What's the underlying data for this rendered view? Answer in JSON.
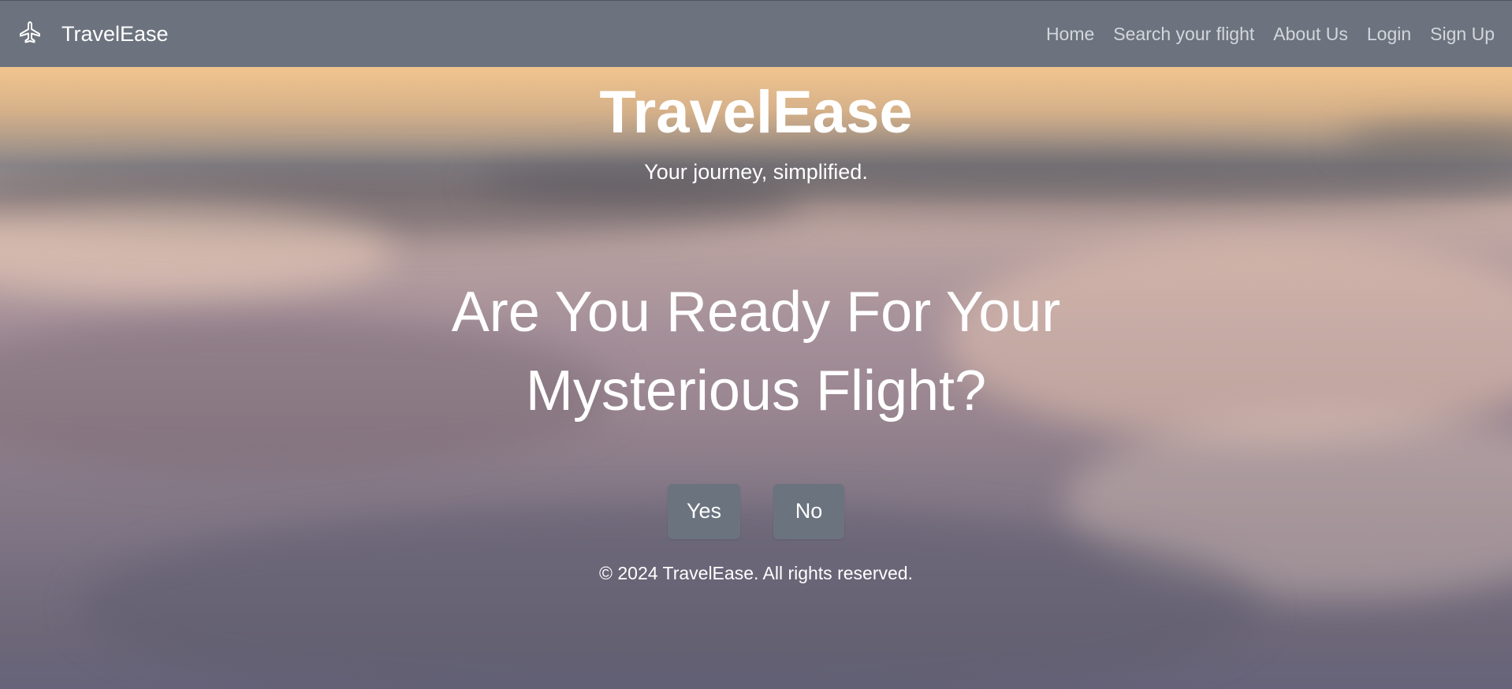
{
  "navbar": {
    "brand_icon": "airplane-icon",
    "brand": "TravelEase",
    "links": [
      "Home",
      "Search your flight",
      "About Us",
      "Login",
      "Sign Up"
    ]
  },
  "hero": {
    "title": "TravelEase",
    "tagline": "Your journey, simplified.",
    "question_line1": "Are You Ready For Your",
    "question_line2": "Mysterious Flight?",
    "yes_label": "Yes",
    "no_label": "No"
  },
  "footer": {
    "copyright": "© 2024 TravelEase. All rights reserved."
  },
  "colors": {
    "navbar_bg": "#6c737e",
    "button_bg": "#6b737f",
    "text_primary": "#ffffff",
    "nav_link": "#d3d6db"
  }
}
